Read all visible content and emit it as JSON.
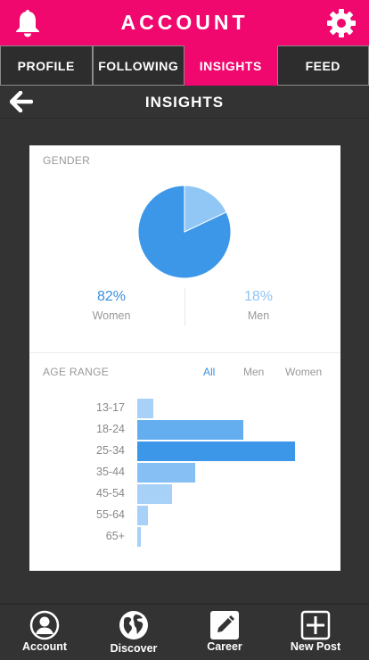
{
  "header": {
    "title": "ACCOUNT",
    "left_icon": "bell-icon",
    "right_icon": "gear-icon",
    "color": "#f0086e"
  },
  "tabs": [
    {
      "label": "PROFILE",
      "active": false
    },
    {
      "label": "FOLLOWING",
      "active": false
    },
    {
      "label": "INSIGHTS",
      "active": true
    },
    {
      "label": "FEED",
      "active": false
    }
  ],
  "subheader": {
    "title": "INSIGHTS",
    "back_icon": "arrow-left-icon"
  },
  "gender": {
    "label": "GENDER",
    "women": {
      "pct": "82%",
      "label": "Women"
    },
    "men": {
      "pct": "18%",
      "label": "Men"
    }
  },
  "age_range": {
    "label": "AGE RANGE",
    "filters": {
      "all": "All",
      "men": "Men",
      "women": "Women"
    },
    "active_filter": "All"
  },
  "chart_data": [
    {
      "type": "pie",
      "categories": [
        "Women",
        "Men"
      ],
      "values": [
        82,
        18
      ],
      "colors": [
        "#3d97e8",
        "#90c7f5"
      ]
    },
    {
      "type": "bar",
      "orientation": "horizontal",
      "categories": [
        "13-17",
        "18-24",
        "25-34",
        "35-44",
        "45-54",
        "55-64",
        "65+"
      ],
      "values": [
        10,
        67,
        100,
        37,
        22,
        7,
        2
      ],
      "colors": [
        "#a8d1f8",
        "#64aef0",
        "#3d97e8",
        "#85bff4",
        "#a8d1f8",
        "#a8d1f8",
        "#a8d1f8"
      ]
    }
  ],
  "bottom_nav": [
    {
      "label": "Account",
      "icon": "user-circle-icon"
    },
    {
      "label": "Discover",
      "icon": "globe-icon"
    },
    {
      "label": "Career",
      "icon": "pencil-icon"
    },
    {
      "label": "New Post",
      "icon": "plus-square-icon"
    }
  ]
}
